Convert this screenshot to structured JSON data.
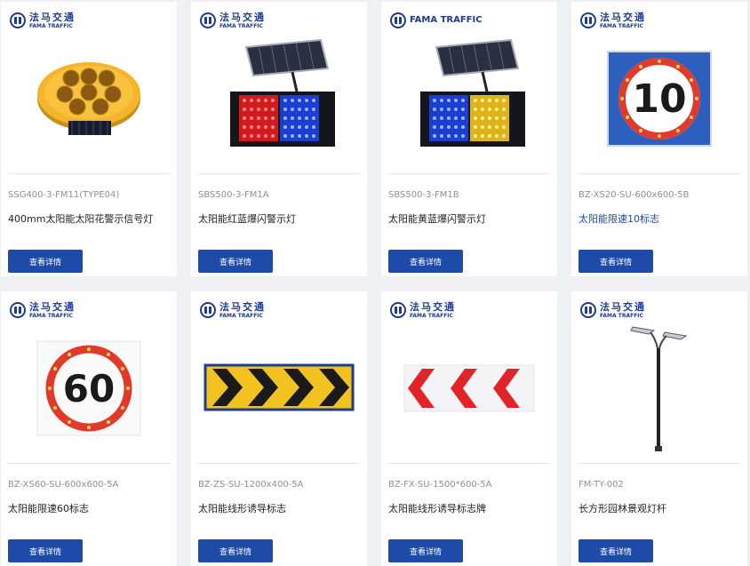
{
  "brand": {
    "cn": "法马交通",
    "en": "FAMA TRAFFIC"
  },
  "button_label": "查看详情",
  "products": [
    {
      "model": "SSG400-3-FM11(TYPE04)",
      "name": "400mm太阳能太阳花警示信号灯",
      "icon": "yellow-solar-warning-light"
    },
    {
      "model": "SBS500-3-FM1A",
      "name": "太阳能红蓝爆闪警示灯",
      "icon": "red-blue-solar-strobe-light"
    },
    {
      "model": "SBS500-3-FM1B",
      "name": "太阳能黄蓝爆闪警示灯",
      "icon": "blue-yellow-solar-strobe-light"
    },
    {
      "model": "BZ-XS20-SU-600x600-5B",
      "name": "太阳能限速10标志",
      "icon": "speed-limit-10-sign",
      "highlight": true
    },
    {
      "model": "BZ-XS60-SU-600x600-5A",
      "name": "太阳能限速60标志",
      "icon": "speed-limit-60-sign"
    },
    {
      "model": "BZ-ZS-SU-1200x400-5A",
      "name": "太阳能线形诱导标志",
      "icon": "yellow-chevron-sign"
    },
    {
      "model": "BZ-FX-SU-1500*600-5A",
      "name": "太阳能线形诱导标志牌",
      "icon": "red-chevron-sign"
    },
    {
      "model": "FM-TY-002",
      "name": "长方形园林景观灯杆",
      "icon": "garden-lamp-post"
    }
  ],
  "sign_numbers": {
    "speed_10": "10",
    "speed_60": "60"
  },
  "colors": {
    "accent": "#1e4aa8",
    "background": "#eef0f3"
  }
}
